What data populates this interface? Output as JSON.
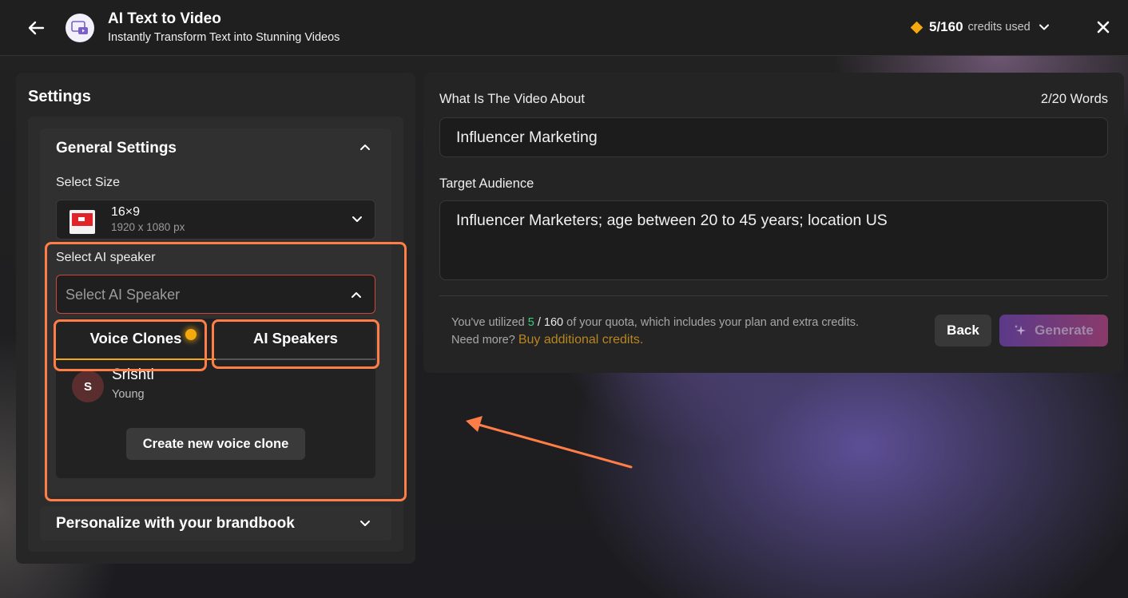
{
  "header": {
    "title": "AI Text to Video",
    "subtitle": "Instantly Transform Text into Stunning Videos",
    "credits_count": "5/160",
    "credits_label": "credits used"
  },
  "settings": {
    "title": "Settings",
    "general": {
      "title": "General Settings",
      "select_size_label": "Select Size",
      "size_name": "16×9",
      "size_dims": "1920 x 1080 px",
      "select_speaker_label": "Select AI speaker",
      "speaker_placeholder": "Select AI Speaker",
      "tabs": [
        "Voice Clones",
        "AI Speakers"
      ],
      "voices": [
        {
          "initial": "S",
          "name": "Srishti",
          "tag": "Young"
        }
      ],
      "create_voice_label": "Create new voice clone"
    },
    "brandbook_title": "Personalize with your brandbook"
  },
  "main": {
    "topic_label": "What Is The Video About",
    "word_count": "2/20 Words",
    "topic_value": "Influencer Marketing",
    "audience_label": "Target Audience",
    "audience_value": "Influencer Marketers; age between 20 to 45 years; location US",
    "quota_prefix": "You've utilized",
    "quota_used": "5",
    "quota_sep": "/",
    "quota_total": "160",
    "quota_suffix": "of your quota, which includes your plan and extra credits.",
    "need_more": "Need more?",
    "buy_link": "Buy additional credits.",
    "back_label": "Back",
    "generate_label": "Generate"
  },
  "colors": {
    "accent_orange": "#ff7e47",
    "credits_diamond": "#f4a90f",
    "quota_used_green": "#3ccf7e",
    "buy_link": "#b8861f"
  }
}
